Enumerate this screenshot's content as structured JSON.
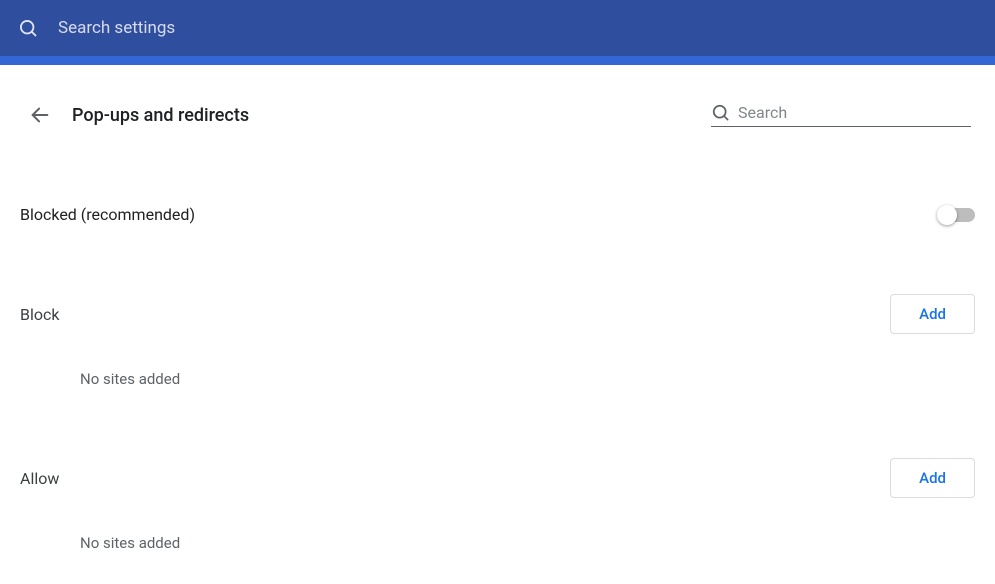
{
  "top_search": {
    "placeholder": "Search settings"
  },
  "header": {
    "title": "Pop-ups and redirects",
    "search_placeholder": "Search"
  },
  "main_setting": {
    "label": "Blocked (recommended)",
    "enabled": false
  },
  "sections": {
    "block": {
      "title": "Block",
      "add_label": "Add",
      "empty_msg": "No sites added"
    },
    "allow": {
      "title": "Allow",
      "add_label": "Add",
      "empty_msg": "No sites added"
    }
  }
}
